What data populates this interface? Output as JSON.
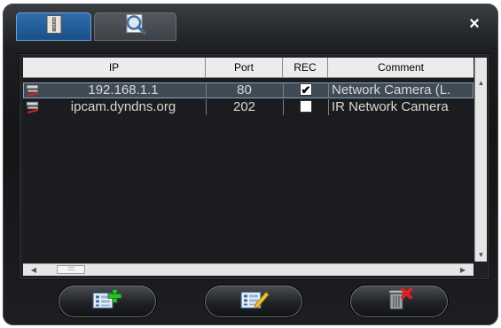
{
  "tabs": [
    {
      "name": "device-list",
      "icon": "device-list-icon"
    },
    {
      "name": "search",
      "icon": "magnifier-icon"
    }
  ],
  "close_label": "×",
  "table": {
    "columns": [
      "IP",
      "Port",
      "REC",
      "Comment"
    ],
    "rows": [
      {
        "ip": "192.168.1.1",
        "port": "80",
        "rec": true,
        "rec_mark": "✔",
        "comment": "Network Camera (L."
      },
      {
        "ip": "ipcam.dyndns.org",
        "port": "202",
        "rec": false,
        "rec_mark": "",
        "comment": "IR Network Camera"
      }
    ]
  },
  "scrollbars": {
    "up": "▲",
    "down": "▼",
    "left": "◀",
    "right": "▶",
    "thumb_grip": "::::::::"
  },
  "buttons": [
    {
      "name": "add-device",
      "icon": "add-entry-icon"
    },
    {
      "name": "edit-device",
      "icon": "edit-entry-icon"
    },
    {
      "name": "delete-device",
      "icon": "trash-delete-icon"
    }
  ],
  "colors": {
    "selected_row": "#3f4b56",
    "tab_active": "#2f6fae"
  }
}
